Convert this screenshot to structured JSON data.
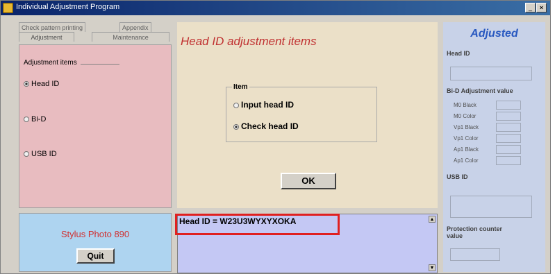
{
  "window": {
    "title": "Individual Adjustment Program",
    "minimize": "_",
    "close": "×"
  },
  "tabs": {
    "row1": [
      "Check pattern printing",
      "Appendix"
    ],
    "row2": [
      "Adjustment",
      "Maintenance"
    ]
  },
  "adjustment_items": {
    "label": "Adjustment items",
    "options": [
      {
        "label": "Head ID",
        "selected": true
      },
      {
        "label": "Bi-D",
        "selected": false
      },
      {
        "label": "USB ID",
        "selected": false
      }
    ]
  },
  "model": {
    "name": "Stylus Photo 890",
    "quit_label": "Quit"
  },
  "center": {
    "title": "Head ID adjustment items",
    "item_label": "Item",
    "options": [
      {
        "label": "Input head ID",
        "selected": false
      },
      {
        "label": "Check head ID",
        "selected": true
      }
    ],
    "ok_label": "OK"
  },
  "output": {
    "text": "Head ID = W23U3WYXYXOKA"
  },
  "adjusted": {
    "title": "Adjusted",
    "head_id_label": "Head ID",
    "bid_label": "Bi-D Adjustment value",
    "bid_rows": [
      "M0 Black",
      "M0 Color",
      "Vp1 Black",
      "Vp1 Color",
      "Ap1 Black",
      "Ap1 Color"
    ],
    "usb_label": "USB ID",
    "counter_label": "Protection counter value"
  },
  "colors": {
    "title_start": "#0a246a",
    "left_panel": "#e8bcc0",
    "model_panel": "#aed4f0",
    "center_panel": "#ebe0c8",
    "output_bg": "#c4c8f4",
    "right_panel": "#c8d2e8",
    "highlight": "#e02020"
  }
}
